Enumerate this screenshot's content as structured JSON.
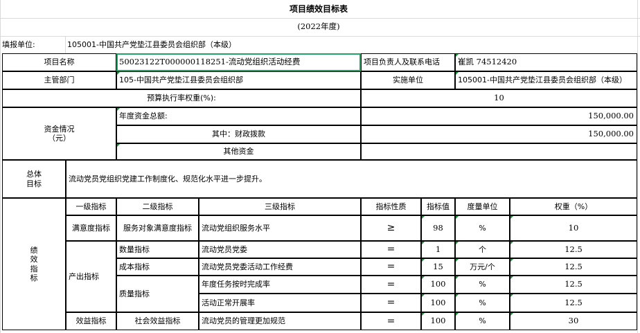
{
  "doc": {
    "title": "项目绩效目标表",
    "year": "(2022年度)"
  },
  "header": {
    "unit_label": "填报单位:",
    "unit_value": "105001-中国共产党垫江县委员会组织部（本级）",
    "proj_name_label": "项目名称",
    "proj_name_value": "50023122T000000118251-流动党组织活动经费",
    "contact_label": "项目负责人及联系电话",
    "contact_value": "崔凯 74512420",
    "dept_label": "主管部门",
    "dept_value": "105-中国共产党垫江县委员会组织部",
    "impl_label": "实施单位",
    "impl_value": "105001-中国共产党垫江县委员会组织部（本级）",
    "weight_label": "预算执行率权重(%):",
    "weight_value": "10"
  },
  "funds": {
    "label_line1": "资金情况",
    "label_line2": "（元）",
    "total_label": "年度资金总额:",
    "total_value": "150,000.00",
    "fiscal_label": "其中：财政拨款",
    "fiscal_value": "150,000.00",
    "other_label": "其他资金",
    "other_value": ""
  },
  "goal": {
    "label_line1": "总体",
    "label_line2": "目标",
    "text": "流动党员党组织党建工作制度化、规范化水平进一步提升。"
  },
  "perf": {
    "side_label": [
      "绩",
      "效",
      "指",
      "标"
    ],
    "headers": {
      "level1": "一级指标",
      "level2": "二级指标",
      "level3": "三级指标",
      "nature": "指标性质",
      "value": "指标值",
      "unit": "度量单位",
      "weight": "权重（%）"
    },
    "level1": {
      "satisfaction": "满意度指标",
      "output": "产出指标",
      "benefit": "效益指标"
    },
    "level2": {
      "service_satisfaction": "服务对象满意度指标",
      "quantity": "数量指标",
      "cost": "成本指标",
      "quality": "质量指标",
      "social_benefit": "社会效益指标"
    },
    "rows": [
      {
        "level3": "流动党组织服务水平",
        "nature": "≥",
        "value": "98",
        "unit": "%",
        "weight": "10"
      },
      {
        "level3": "流动党员党委",
        "nature": "=",
        "value": "1",
        "unit": "个",
        "weight": "12.5"
      },
      {
        "level3": "流动党员党委活动工作经费",
        "nature": "=",
        "value": "15",
        "unit": "万元/个",
        "weight": "12.5"
      },
      {
        "level3": "年度任务按时完成率",
        "nature": "=",
        "value": "100",
        "unit": "%",
        "weight": "12.5"
      },
      {
        "level3": "活动正常开展率",
        "nature": "=",
        "value": "100",
        "unit": "%",
        "weight": "12.5"
      },
      {
        "level3": "流动党员的管理更加规范",
        "nature": "=",
        "value": "100",
        "unit": "%",
        "weight": "30"
      }
    ]
  },
  "colors": {
    "selection": "#21a366",
    "comment_marker": "#1a8f3a",
    "gridline": "#d9d9d9"
  }
}
